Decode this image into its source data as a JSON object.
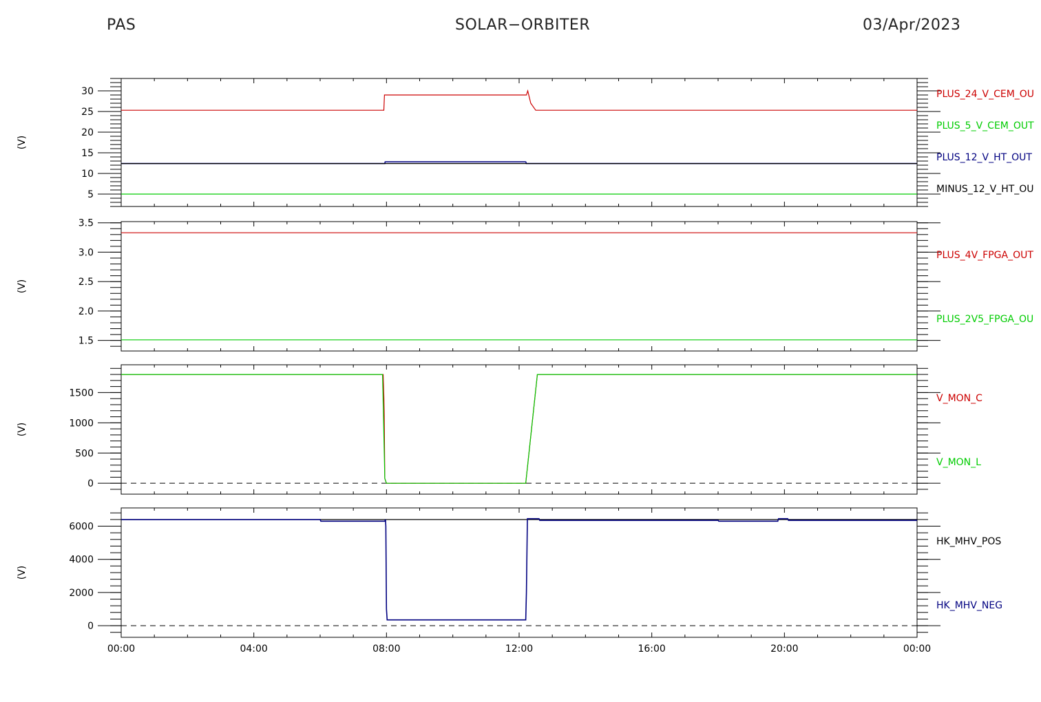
{
  "header": {
    "instrument": "PAS",
    "mission": "SOLAR−ORBITER",
    "date": "03/Apr/2023"
  },
  "chart_data": {
    "type": "line",
    "x_ticks": [
      "00:00",
      "04:00",
      "08:00",
      "12:00",
      "16:00",
      "20:00",
      "00:00"
    ],
    "x_range_hours": [
      0,
      24
    ],
    "panels": [
      {
        "ylabel": "(V)",
        "ylim": [
          2,
          33
        ],
        "yticks": [
          5,
          10,
          15,
          20,
          25,
          30
        ],
        "series": [
          {
            "name": "PLUS_24_V_CEM_OU",
            "color": "#cc0000",
            "x": [
              0,
              7.92,
              7.94,
              12.22,
              12.26,
              12.35,
              12.5,
              24
            ],
            "y": [
              25.3,
              25.3,
              29.0,
              29.0,
              30.0,
              27.0,
              25.3,
              25.3
            ]
          },
          {
            "name": "PLUS_5_V_CEM_OUT",
            "color": "#00cc00",
            "x": [
              0,
              24
            ],
            "y": [
              5.0,
              5.0
            ]
          },
          {
            "name": "PLUS_12_V_HT_OUT",
            "color": "#000080",
            "x": [
              0,
              7.95,
              7.96,
              12.2,
              12.22,
              24
            ],
            "y": [
              12.4,
              12.4,
              12.8,
              12.8,
              12.4,
              12.4
            ]
          },
          {
            "name": "MINUS_12_V_HT_OU",
            "color": "#000000",
            "x": [
              0,
              24
            ],
            "y": [
              12.4,
              12.4
            ]
          }
        ]
      },
      {
        "ylabel": "(V)",
        "ylim": [
          1.32,
          3.52
        ],
        "yticks": [
          1.5,
          2.0,
          2.5,
          3.0,
          3.5
        ],
        "ytick_labels": [
          "1.5",
          "2.0",
          "2.5",
          "3.0",
          "3.5"
        ],
        "series": [
          {
            "name": "PLUS_4V_FPGA_OUT",
            "color": "#cc0000",
            "x": [
              0,
              24
            ],
            "y": [
              3.33,
              3.33
            ]
          },
          {
            "name": "PLUS_2V5_FPGA_OU",
            "color": "#00cc00",
            "x": [
              0,
              24
            ],
            "y": [
              1.51,
              1.51
            ]
          }
        ]
      },
      {
        "ylabel": "(V)",
        "ylim": [
          -180,
          1960
        ],
        "yticks": [
          0,
          500,
          1000,
          1500
        ],
        "zero_line": true,
        "series": [
          {
            "name": "V_MON_C",
            "color": "#cc0000",
            "x": [
              0,
              7.9,
              7.92,
              7.93,
              7.95,
              8.0,
              12.2,
              12.55,
              24
            ],
            "y": [
              1800,
              1800,
              1450,
              1200,
              80,
              0,
              0,
              1800,
              1800
            ]
          },
          {
            "name": "V_MON_L",
            "color": "#00cc00",
            "x": [
              0,
              7.88,
              7.95,
              8.0,
              12.2,
              12.55,
              24
            ],
            "y": [
              1800,
              1800,
              80,
              0,
              0,
              1800,
              1800
            ]
          }
        ]
      },
      {
        "ylabel": "(V)",
        "ylim": [
          -700,
          7100
        ],
        "yticks": [
          0,
          2000,
          4000,
          6000
        ],
        "zero_line": true,
        "series": [
          {
            "name": "HK_MHV_POS",
            "color": "#000000",
            "x": [
              0,
              24
            ],
            "y": [
              6400,
              6400
            ]
          },
          {
            "name": "HK_MHV_NEG",
            "color": "#000080",
            "x": [
              0,
              6.0,
              6.02,
              7.95,
              7.97,
              7.98,
              8.0,
              8.02,
              12.2,
              12.22,
              12.25,
              12.6,
              12.62,
              18.0,
              18.02,
              19.8,
              19.82,
              20.1,
              20.12,
              24
            ],
            "y": [
              6400,
              6400,
              6300,
              6300,
              6400,
              6000,
              1000,
              350,
              350,
              2000,
              6450,
              6450,
              6350,
              6350,
              6300,
              6300,
              6450,
              6450,
              6350,
              6350
            ]
          }
        ]
      }
    ]
  }
}
